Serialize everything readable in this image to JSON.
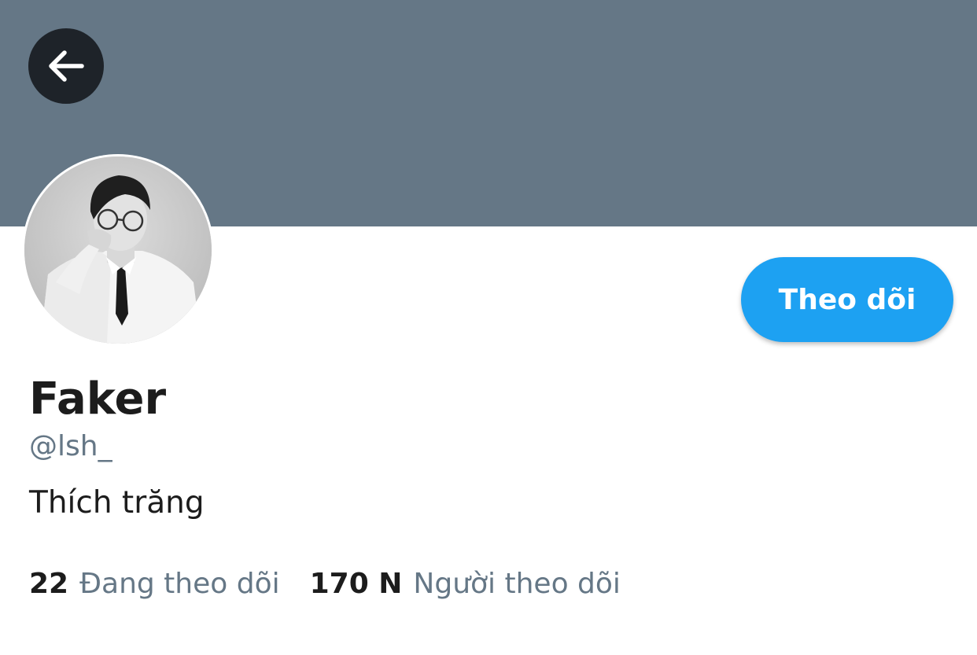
{
  "profile": {
    "display_name": "Faker",
    "handle": "@lsh_",
    "bio": "Thích trăng",
    "follow_label": "Theo dõi",
    "stats": {
      "following_count": "22",
      "following_label": "Đang theo dõi",
      "followers_count": "170 N",
      "followers_label": "Người theo dõi"
    }
  },
  "icons": {
    "back": "arrow-left-icon"
  },
  "colors": {
    "banner": "#657786",
    "accent": "#1da1f2",
    "secondary_text": "#657786",
    "primary_text": "#1c1c1c",
    "back_button_bg": "#1e2329"
  }
}
